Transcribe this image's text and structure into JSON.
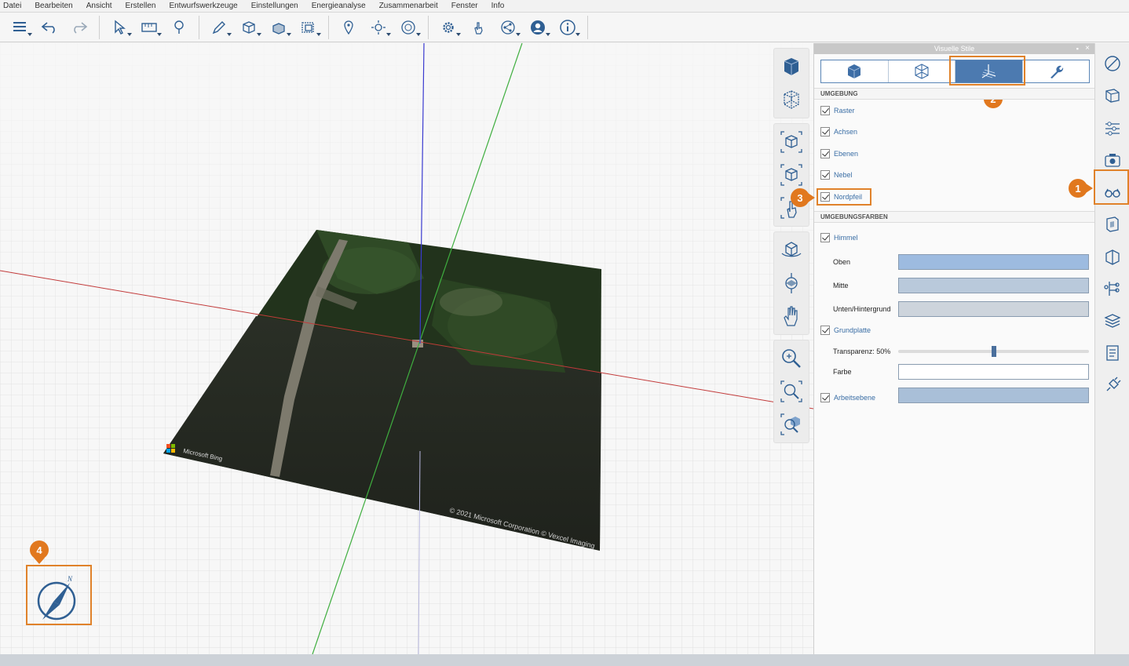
{
  "menu": [
    "Datei",
    "Bearbeiten",
    "Ansicht",
    "Erstellen",
    "Entwurfswerkzeuge",
    "Einstellungen",
    "Energieanalyse",
    "Zusammenarbeit",
    "Fenster",
    "Info"
  ],
  "toolbar": {
    "icons": [
      "layers-icon",
      "undo-icon",
      "redo-icon",
      "select-icon",
      "measure-icon",
      "pin-icon",
      "pencil-icon",
      "add-solid-icon",
      "edit-solid-icon",
      "boolean-icon",
      "location-icon",
      "sun-icon",
      "shadow-icon",
      "settings-icon",
      "gesture-icon",
      "share-icon",
      "account-icon",
      "info-icon"
    ]
  },
  "viewport": {
    "map_copyright": "© 2021 Microsoft Corporation © Vexcel Imaging",
    "map_brand": "Microsoft Bing",
    "north_letter": "N",
    "callout_4": "4"
  },
  "panel": {
    "title": "Visuelle Stile",
    "pin": "▪",
    "close": "×",
    "callout_2": "2",
    "callout_3": "3",
    "section_environment": "UMGEBUNG",
    "environment": [
      {
        "label": "Raster",
        "checked": true
      },
      {
        "label": "Achsen",
        "checked": true
      },
      {
        "label": "Ebenen",
        "checked": true
      },
      {
        "label": "Nebel",
        "checked": true
      },
      {
        "label": "Nordpfeil",
        "checked": true
      }
    ],
    "section_colors": "UMGEBUNGSFARBEN",
    "sky_label": "Himmel",
    "top_label": "Oben",
    "mid_label": "Mitte",
    "bottom_label": "Unten/Hintergrund",
    "ground_label": "Grundplatte",
    "transparency_label": "Transparenz: 50%",
    "transparency_value": 0.5,
    "color_label": "Farbe",
    "workplane_label": "Arbeitsebene",
    "colors": {
      "top": "#9dbbe0",
      "mid": "#b9c9db",
      "bottom": "#cdd4dc",
      "ground": "#ffffff",
      "workplane": "#a9bfd8"
    }
  },
  "rightbar": {
    "callout_1": "1"
  }
}
